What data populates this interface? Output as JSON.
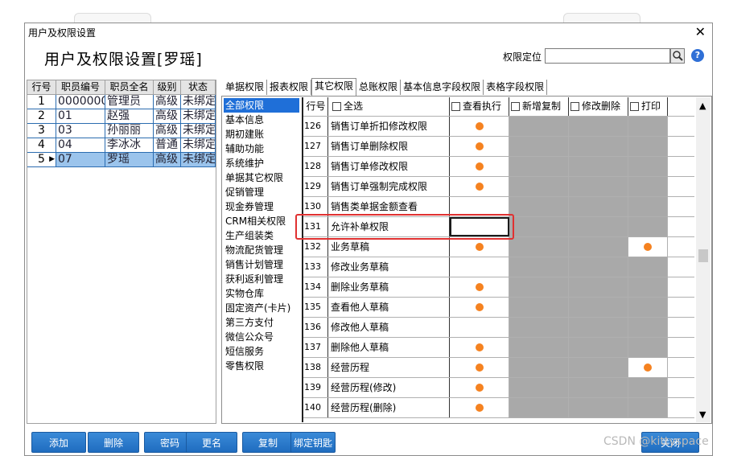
{
  "window": {
    "title": "用户及权限设置",
    "close_glyph": "✕"
  },
  "header": {
    "title": "用户及权限设置[罗瑶]",
    "locate_label": "权限定位",
    "locate_value": "",
    "help_glyph": "?"
  },
  "employees": {
    "columns": [
      "行号",
      "职员编号",
      "职员全名",
      "级别",
      "状态"
    ],
    "rows": [
      {
        "no": "1",
        "code": "00000000",
        "name": "管理员",
        "level": "高级",
        "status": "未绑定"
      },
      {
        "no": "2",
        "code": "01",
        "name": "赵强",
        "level": "高级",
        "status": "未绑定"
      },
      {
        "no": "3",
        "code": "03",
        "name": "孙丽丽",
        "level": "高级",
        "status": "未绑定"
      },
      {
        "no": "4",
        "code": "04",
        "name": "李冰冰",
        "level": "普通",
        "status": "未绑定"
      },
      {
        "no": "5",
        "code": "07",
        "name": "罗瑶",
        "level": "高级",
        "status": "未绑定"
      }
    ]
  },
  "tabs": [
    "单据权限",
    "报表权限",
    "其它权限",
    "总账权限",
    "基本信息字段权限",
    "表格字段权限"
  ],
  "categories": [
    "全部权限",
    "基本信息",
    "期初建账",
    "辅助功能",
    "系统维护",
    "单据其它权限",
    "促销管理",
    "现金券管理",
    "CRM相关权限",
    "生产组装类",
    "物流配货管理",
    "销售计划管理",
    "获利返利管理",
    "实物仓库",
    "固定资产(卡片)",
    "第三方支付",
    "微信公众号",
    "短信服务",
    "零售权限"
  ],
  "grid": {
    "headers": {
      "no": "行号",
      "all": "全选",
      "exec": "查看执行",
      "copy": "新增复制",
      "modify": "修改删除",
      "print": "打印"
    },
    "rows": [
      {
        "no": "126",
        "name": "销售订单折扣修改权限",
        "exec": true,
        "copy": null,
        "modify": null,
        "print": null
      },
      {
        "no": "127",
        "name": "销售订单删除权限",
        "exec": true,
        "copy": null,
        "modify": null,
        "print": null
      },
      {
        "no": "128",
        "name": "销售订单修改权限",
        "exec": true,
        "copy": null,
        "modify": null,
        "print": null
      },
      {
        "no": "129",
        "name": "销售订单强制完成权限",
        "exec": true,
        "copy": null,
        "modify": null,
        "print": null
      },
      {
        "no": "130",
        "name": "销售类单据金额查看",
        "exec": false,
        "copy": null,
        "modify": null,
        "print": null
      },
      {
        "no": "131",
        "name": "允许补单权限",
        "exec": false,
        "copy": null,
        "modify": null,
        "print": null
      },
      {
        "no": "132",
        "name": "业务草稿",
        "exec": true,
        "copy": null,
        "modify": null,
        "print": true
      },
      {
        "no": "133",
        "name": "修改业务草稿",
        "exec": false,
        "copy": null,
        "modify": null,
        "print": null
      },
      {
        "no": "134",
        "name": "删除业务草稿",
        "exec": true,
        "copy": null,
        "modify": null,
        "print": null
      },
      {
        "no": "135",
        "name": "查看他人草稿",
        "exec": true,
        "copy": null,
        "modify": null,
        "print": null
      },
      {
        "no": "136",
        "name": "修改他人草稿",
        "exec": false,
        "copy": null,
        "modify": null,
        "print": null
      },
      {
        "no": "137",
        "name": "删除他人草稿",
        "exec": true,
        "copy": null,
        "modify": null,
        "print": null
      },
      {
        "no": "138",
        "name": "经营历程",
        "exec": true,
        "copy": null,
        "modify": null,
        "print": true
      },
      {
        "no": "139",
        "name": "经营历程(修改)",
        "exec": true,
        "copy": null,
        "modify": null,
        "print": null
      },
      {
        "no": "140",
        "name": "经营历程(删除)",
        "exec": true,
        "copy": null,
        "modify": null,
        "print": null
      }
    ]
  },
  "buttons": [
    "添加",
    "删除",
    "密码",
    "更名",
    "复制",
    "绑定钥匙",
    "关闭"
  ],
  "watermark": "CSDN @kittyspace",
  "colors": {
    "accent": "#1f6fd8",
    "dot": "#f58220",
    "highlight": "#e03131",
    "disabled": "#a9a9a9"
  }
}
